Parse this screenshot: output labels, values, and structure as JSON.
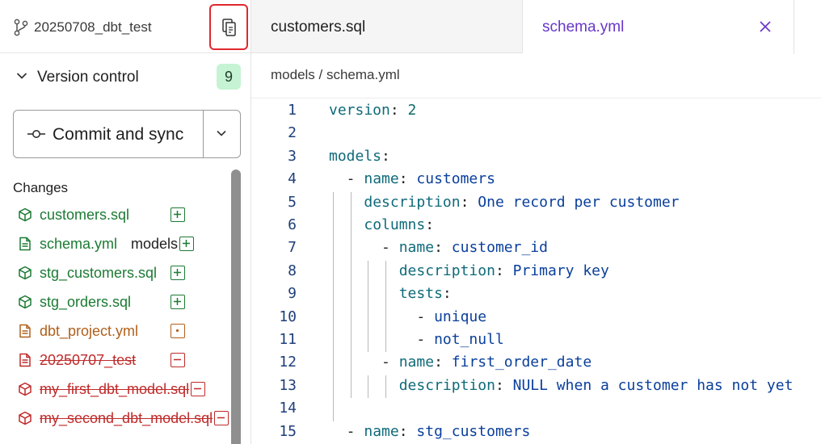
{
  "sidebar": {
    "branch_name": "20250708_dbt_test",
    "version_control": {
      "title": "Version control",
      "badge_count": "9"
    },
    "commit_button_label": "Commit and sync",
    "changes_title": "Changes",
    "changes": [
      {
        "file": "customers.sql",
        "dir": "",
        "status": "added",
        "file_icon": "model-cube-icon"
      },
      {
        "file": "schema.yml",
        "dir": "models",
        "status": "added",
        "file_icon": "document-icon"
      },
      {
        "file": "stg_customers.sql",
        "dir": "",
        "status": "added",
        "file_icon": "model-cube-icon"
      },
      {
        "file": "stg_orders.sql",
        "dir": "",
        "status": "added",
        "file_icon": "model-cube-icon"
      },
      {
        "file": "dbt_project.yml",
        "dir": "",
        "status": "modified",
        "file_icon": "document-icon"
      },
      {
        "file": "20250707_test",
        "dir": "",
        "status": "deleted",
        "file_icon": "document-icon"
      },
      {
        "file": "my_first_dbt_model.sql",
        "dir": "",
        "status": "deleted",
        "file_icon": "model-cube-icon"
      },
      {
        "file": "my_second_dbt_model.sql",
        "dir": "",
        "status": "deleted",
        "file_icon": "model-cube-icon"
      }
    ]
  },
  "tabs": [
    {
      "label": "customers.sql",
      "active": false
    },
    {
      "label": "schema.yml",
      "active": true
    }
  ],
  "breadcrumb": "models / schema.yml",
  "code": [
    {
      "n": "1",
      "indent": 0,
      "key": "version",
      "val": "2",
      "dash": false
    },
    {
      "n": "2",
      "indent": 0,
      "key": "",
      "val": "",
      "dash": false
    },
    {
      "n": "3",
      "indent": 0,
      "key": "models",
      "val": "",
      "dash": false
    },
    {
      "n": "4",
      "indent": 1,
      "key": "name",
      "val": "customers",
      "dash": true
    },
    {
      "n": "5",
      "indent": 2,
      "key": "description",
      "val": "One record per customer",
      "dash": false
    },
    {
      "n": "6",
      "indent": 2,
      "key": "columns",
      "val": "",
      "dash": false
    },
    {
      "n": "7",
      "indent": 3,
      "key": "name",
      "val": "customer_id",
      "dash": true
    },
    {
      "n": "8",
      "indent": 4,
      "key": "description",
      "val": "Primary key",
      "dash": false
    },
    {
      "n": "9",
      "indent": 4,
      "key": "tests",
      "val": "",
      "dash": false
    },
    {
      "n": "10",
      "indent": 5,
      "key": "",
      "val": "unique",
      "dash": true
    },
    {
      "n": "11",
      "indent": 5,
      "key": "",
      "val": "not_null",
      "dash": true
    },
    {
      "n": "12",
      "indent": 3,
      "key": "name",
      "val": "first_order_date",
      "dash": true
    },
    {
      "n": "13",
      "indent": 4,
      "key": "description",
      "val": "NULL when a customer has not yet",
      "dash": false
    },
    {
      "n": "14",
      "indent": 0,
      "key": "",
      "val": "",
      "dash": false
    },
    {
      "n": "15",
      "indent": 1,
      "key": "name",
      "val": "stg_customers",
      "dash": true
    }
  ],
  "colors": {
    "added": "#1c7a33",
    "modified": "#b1601b",
    "deleted": "#c02a2a",
    "active_tab": "#6937c9",
    "highlight_box": "#e0282e",
    "badge_bg": "#c6f3d3"
  },
  "icons": {
    "branch": "git-branch-icon",
    "copy": "copy-icon",
    "chevron": "chevron-down-icon",
    "commit": "git-commit-icon",
    "close": "close-icon"
  }
}
